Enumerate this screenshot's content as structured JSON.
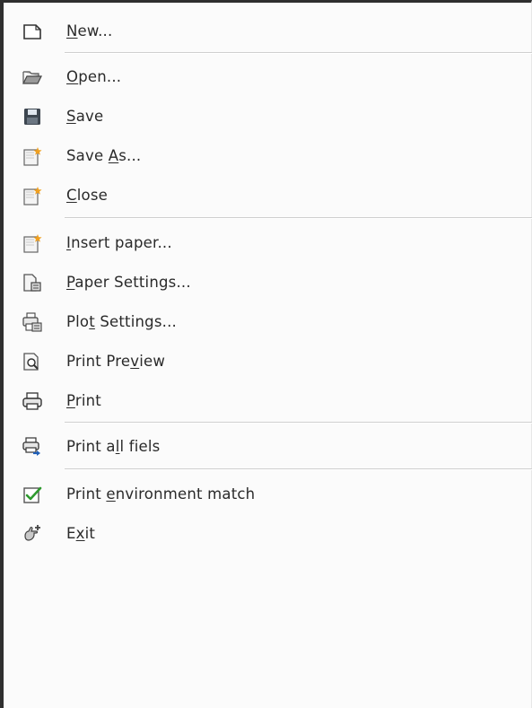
{
  "menu": {
    "items": [
      {
        "id": "new",
        "label": "New...",
        "mnemonic_index": 0,
        "icon": "new-document-icon"
      },
      {
        "id": "open",
        "label": "Open...",
        "mnemonic_index": 0,
        "icon": "open-folder-icon"
      },
      {
        "id": "save",
        "label": "Save",
        "mnemonic_index": 0,
        "icon": "floppy-disk-icon"
      },
      {
        "id": "save-as",
        "label": "Save As...",
        "mnemonic_index": 5,
        "icon": "new-sheet-icon"
      },
      {
        "id": "close",
        "label": "Close",
        "mnemonic_index": 0,
        "icon": "new-sheet-icon"
      },
      {
        "id": "insert-paper",
        "label": "Insert paper...",
        "mnemonic_index": 0,
        "icon": "new-sheet-icon"
      },
      {
        "id": "paper-settings",
        "label": "Paper Settings...",
        "mnemonic_index": 0,
        "icon": "page-setup-icon"
      },
      {
        "id": "plot-settings",
        "label": "Plot Settings...",
        "mnemonic_index": 3,
        "icon": "printer-setup-icon"
      },
      {
        "id": "print-preview",
        "label": "Print Preview",
        "mnemonic_index": 9,
        "icon": "print-preview-icon"
      },
      {
        "id": "print",
        "label": "Print",
        "mnemonic_index": 0,
        "icon": "printer-icon"
      },
      {
        "id": "print-all-fiels",
        "label": "Print all fiels",
        "mnemonic_index": 7,
        "icon": "batch-print-icon"
      },
      {
        "id": "print-env-match",
        "label": "Print environment match",
        "mnemonic_index": 6,
        "icon": "checkbox-check-icon"
      },
      {
        "id": "exit",
        "label": "Exit",
        "mnemonic_index": 1,
        "icon": "exit-hand-icon"
      }
    ]
  },
  "colors": {
    "text": "#2a2a2a",
    "separator": "#cfcfcf",
    "background": "#fbfbfb",
    "check_green": "#2e9a2e",
    "accent_orange": "#f0a020",
    "arrow_blue": "#1f5fb8"
  }
}
